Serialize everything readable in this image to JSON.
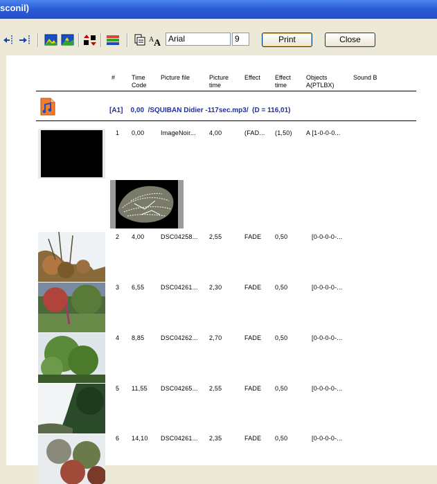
{
  "window": {
    "title": "sconil)"
  },
  "toolbar": {
    "font_name": "Arial",
    "font_size": "9",
    "print_label": "Print",
    "close_label": "Close"
  },
  "table": {
    "headers": {
      "num": "#",
      "time_code": "Time\nCode",
      "picture_file": "Picture file",
      "picture_time": "Picture\ntime",
      "effect": "Effect",
      "effect_time": "Effect\ntime",
      "objects": "Objects\nA(PTLBX)",
      "sound_b": "Sound B"
    },
    "sound_a_line": "[A1]    0,00  /SQUIBAN Didier -117sec.mp3/  (D = 116,01)",
    "rows": [
      {
        "num": "1",
        "time_code": "0,00",
        "file": "ImageNoir...",
        "pic_time": "4,00",
        "effect": "(FAD...",
        "effect_time": "(1,50)",
        "objects": "A [1-0-0-0..."
      },
      {
        "num": "2",
        "time_code": "4,00",
        "file": "DSC04258...",
        "pic_time": "2,55",
        "effect": "FADE",
        "effect_time": "0,50",
        "objects": "[0-0-0-0-..."
      },
      {
        "num": "3",
        "time_code": "6,55",
        "file": "DSC04261...",
        "pic_time": "2,30",
        "effect": "FADE",
        "effect_time": "0,50",
        "objects": "[0-0-0-0-..."
      },
      {
        "num": "4",
        "time_code": "8,85",
        "file": "DSC04262...",
        "pic_time": "2,70",
        "effect": "FADE",
        "effect_time": "0,50",
        "objects": "[0-0-0-0-..."
      },
      {
        "num": "5",
        "time_code": "11,55",
        "file": "DSC04265...",
        "pic_time": "2,55",
        "effect": "FADE",
        "effect_time": "0,50",
        "objects": "[0-0-0-0-..."
      },
      {
        "num": "6",
        "time_code": "14,10",
        "file": "DSC04261...",
        "pic_time": "2,35",
        "effect": "FADE",
        "effect_time": "0,50",
        "objects": "[0-0-0-0-..."
      }
    ]
  },
  "colors": {
    "sound_line": "#1f2ca8",
    "titlebar": "#2a5bd6"
  }
}
